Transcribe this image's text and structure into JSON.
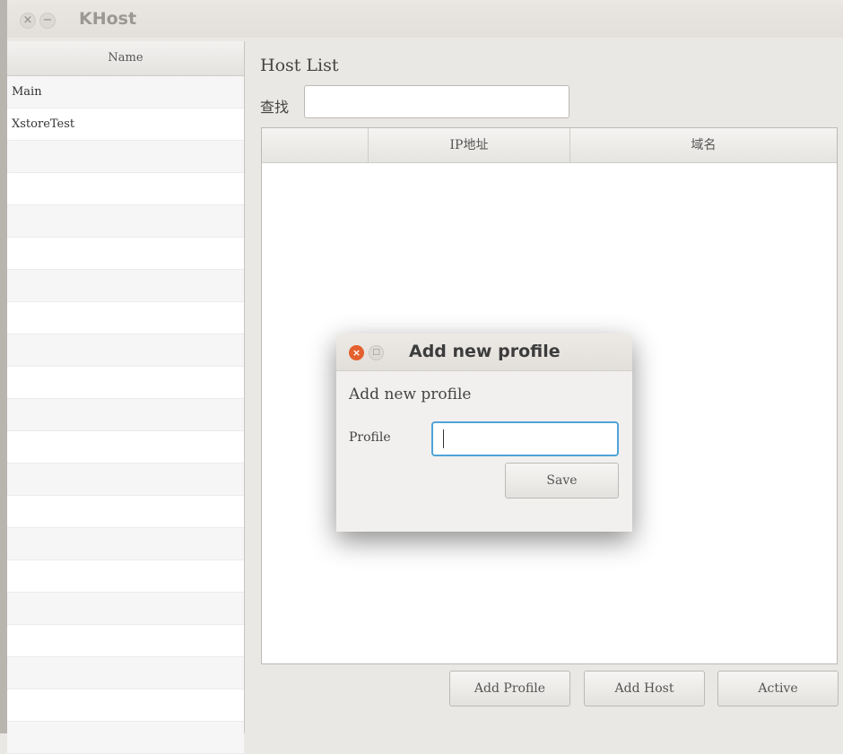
{
  "window": {
    "title": "KHost"
  },
  "sidebar": {
    "column_header": "Name",
    "items": [
      {
        "label": "Main"
      },
      {
        "label": "XstoreTest"
      },
      {
        "label": ""
      },
      {
        "label": ""
      },
      {
        "label": ""
      },
      {
        "label": ""
      },
      {
        "label": ""
      },
      {
        "label": ""
      },
      {
        "label": ""
      },
      {
        "label": ""
      },
      {
        "label": ""
      },
      {
        "label": ""
      },
      {
        "label": ""
      },
      {
        "label": ""
      },
      {
        "label": ""
      },
      {
        "label": ""
      },
      {
        "label": ""
      },
      {
        "label": ""
      },
      {
        "label": ""
      },
      {
        "label": ""
      },
      {
        "label": ""
      }
    ]
  },
  "main": {
    "title": "Host List",
    "search": {
      "label": "查找",
      "value": "",
      "placeholder": ""
    },
    "table": {
      "columns": [
        "",
        "IP地址",
        "域名"
      ],
      "rows": []
    },
    "buttons": {
      "add_profile": "Add Profile",
      "add_host": "Add Host",
      "active": "Active"
    }
  },
  "dialog": {
    "title": "Add new profile",
    "heading": "Add new profile",
    "field_label": "Profile",
    "field_value": "",
    "save_label": "Save",
    "close_icon": "×",
    "maximize_icon": "□"
  },
  "colors": {
    "dialog_close": "#e4602e",
    "input_focus": "#4fa3d8"
  }
}
